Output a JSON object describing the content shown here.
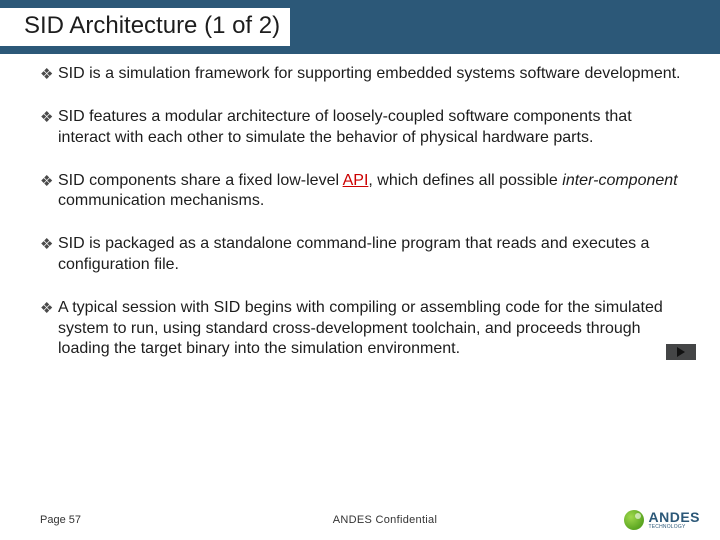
{
  "title": "SID Architecture (1 of 2)",
  "bullets": [
    {
      "pre": "SID is a simulation framework for supporting embedded systems software development.",
      "hl": "",
      "hlClass": "",
      "post": ""
    },
    {
      "pre": "SID features a modular architecture of loosely-coupled software components that interact with each other to simulate the behavior of physical hardware parts.",
      "hl": "",
      "hlClass": "",
      "post": ""
    },
    {
      "pre": "SID components share a fixed low-level ",
      "hl": "API",
      "hlClass": "hl-red hl-underline",
      "post": ", which defines all possible <span class=\"hl-italic\">inter-component</span> communication mechanisms."
    },
    {
      "pre": "SID is packaged as a standalone command-line program that reads and executes a configuration file.",
      "hl": "",
      "hlClass": "",
      "post": ""
    },
    {
      "pre": "A typical session with SID begins with compiling or assembling code for the simulated system to run, using standard cross-development toolchain, and proceeds through loading the target binary into the simulation environment.",
      "hl": "",
      "hlClass": "",
      "post": ""
    }
  ],
  "bulletGlyph": "❖",
  "footer": {
    "page": "Page 57",
    "confidential": "ANDES Confidential",
    "logoText": "ANDES",
    "logoSub": "TECHNOLOGY"
  }
}
